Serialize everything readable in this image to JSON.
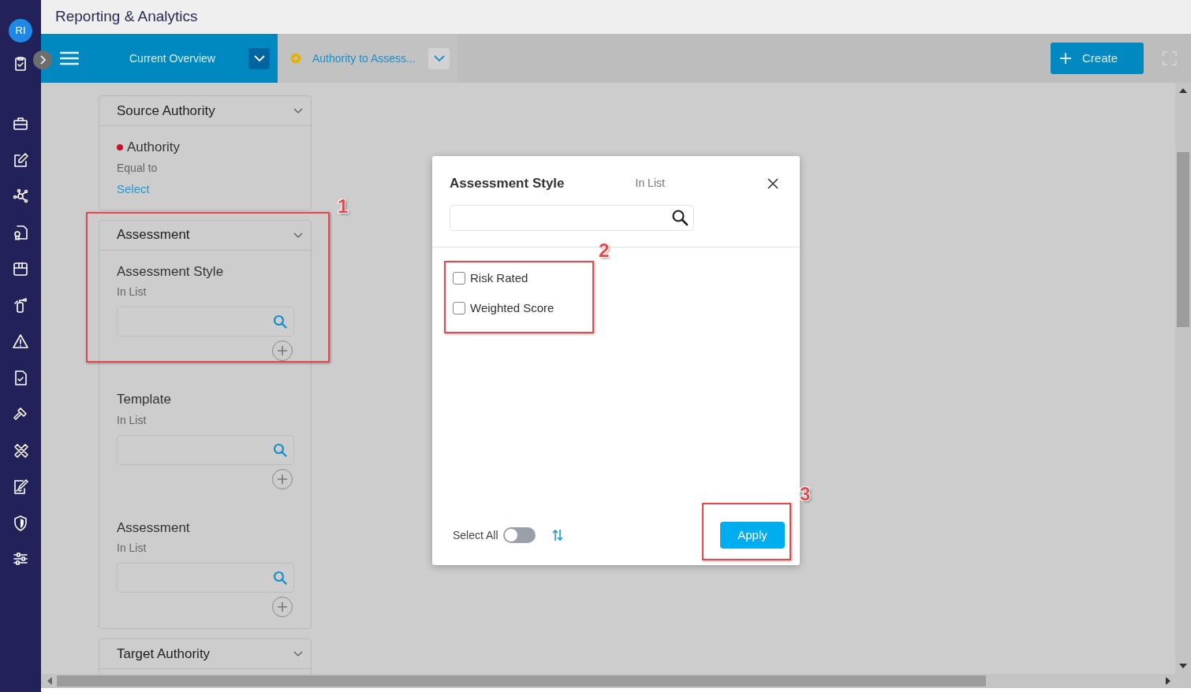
{
  "app": {
    "avatar": "RI",
    "title": "Reporting & Analytics"
  },
  "toolbar": {
    "tabs": [
      {
        "label": "Current Overview",
        "selected": true
      },
      {
        "label": "Authority to Assess...",
        "selected": false
      }
    ],
    "create_button": "Create"
  },
  "filters": [
    {
      "title": "Source Authority",
      "fields": [
        {
          "kind": "select",
          "label": "Authority",
          "required": true,
          "operator": "Equal to",
          "link": "Select"
        }
      ]
    },
    {
      "title": "Assessment",
      "fields": [
        {
          "kind": "search",
          "label": "Assessment Style",
          "required": false,
          "operator": "In List"
        },
        {
          "kind": "search",
          "label": "Template",
          "required": false,
          "operator": "In List"
        },
        {
          "kind": "search",
          "label": "Assessment",
          "required": false,
          "operator": "In List"
        }
      ]
    },
    {
      "title": "Target Authority"
    }
  ],
  "modal": {
    "title": "Assessment Style",
    "operator": "In List",
    "options": [
      {
        "label": "Risk Rated",
        "checked": false
      },
      {
        "label": "Weighted Score",
        "checked": false
      }
    ],
    "select_all": {
      "label": "Select All",
      "on": false
    },
    "apply_button": "Apply"
  },
  "annotations": [
    {
      "label": "1"
    },
    {
      "label": "2"
    },
    {
      "label": "3"
    }
  ]
}
